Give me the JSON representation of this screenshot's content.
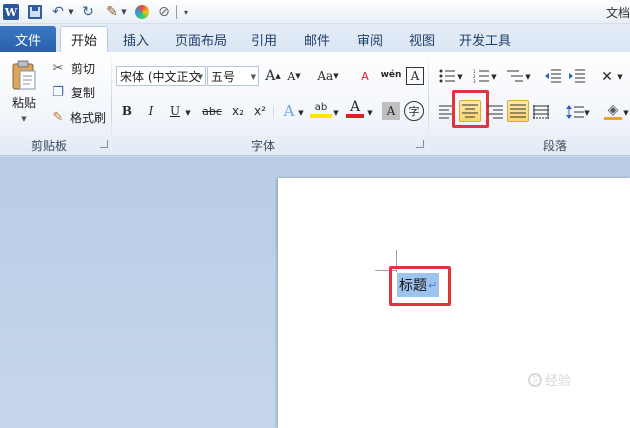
{
  "window": {
    "title": "文档"
  },
  "tabs": [
    {
      "label": "文件"
    },
    {
      "label": "开始"
    },
    {
      "label": "插入"
    },
    {
      "label": "页面布局"
    },
    {
      "label": "引用"
    },
    {
      "label": "邮件"
    },
    {
      "label": "审阅"
    },
    {
      "label": "视图"
    },
    {
      "label": "开发工具"
    }
  ],
  "clipboard": {
    "paste": "粘贴",
    "cut": "剪切",
    "copy": "复制",
    "format_painter": "格式刷",
    "label": "剪贴板"
  },
  "font": {
    "name": "宋体 (中文正文",
    "size": "五号",
    "grow": "A",
    "shrink": "A",
    "change_case": "Aa",
    "clear_format": "A",
    "phonetic": "wén",
    "border_char": "A",
    "bold": "B",
    "italic": "I",
    "underline": "U",
    "strike": "abc",
    "subscript": "x₂",
    "superscript": "x²",
    "text_effect": "A",
    "highlight": "ab",
    "font_color": "A",
    "char_shading": "A",
    "enclose": "字",
    "label": "字体"
  },
  "paragraph": {
    "label": "段落"
  },
  "document": {
    "text": "标题",
    "para_mark": "↵",
    "watermark": "经验"
  },
  "colors": {
    "highlight_box": "#e0353f",
    "active_align": "#fbd46a",
    "selection": "#9ec3ec",
    "file_tab": "#2a5fa9"
  }
}
